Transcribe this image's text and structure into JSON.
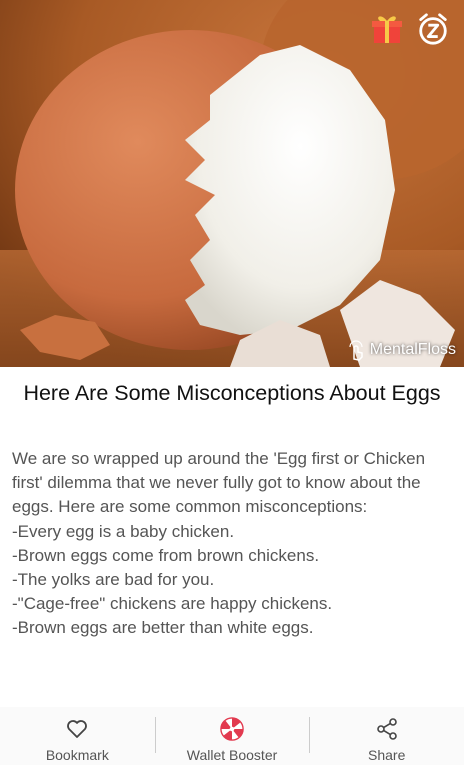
{
  "hero": {
    "source_label": "MentalFloss"
  },
  "top_icons": {
    "gift": "gift-icon",
    "snooze": "snooze-alarm-icon"
  },
  "article": {
    "title": "Here Are Some Misconceptions About Eggs",
    "body": "We are so wrapped up around the 'Egg first or Chicken first' dilemma that we never fully got to know about the eggs. Here are some common misconceptions:\n-Every egg is a baby chicken.\n-Brown eggs come from brown chickens.\n-The yolks are bad for you.\n-\"Cage-free\" chickens are happy chickens.\n-Brown eggs are better than white eggs."
  },
  "bottom_bar": {
    "bookmark_label": "Bookmark",
    "wallet_label": "Wallet Booster",
    "share_label": "Share"
  },
  "colors": {
    "accent": "#e23a4f",
    "gift": "#f0433a",
    "gift_ribbon": "#f7c948"
  }
}
